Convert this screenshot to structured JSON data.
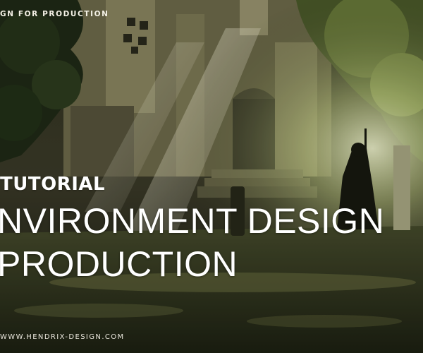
{
  "header": {
    "label": "GN FOR PRODUCTION"
  },
  "hero": {
    "kicker": "TUTORIAL",
    "title_line_1": "NVIRONMENT DESIGN",
    "title_line_2": "PRODUCTION"
  },
  "footer": {
    "website": "WWW.HENDRIX-DESIGN.COM"
  },
  "colors": {
    "text": "#ffffff",
    "moss": "#3e4a22",
    "stone": "#8a8460",
    "light": "#e8f0b8",
    "shadow": "#121510"
  }
}
